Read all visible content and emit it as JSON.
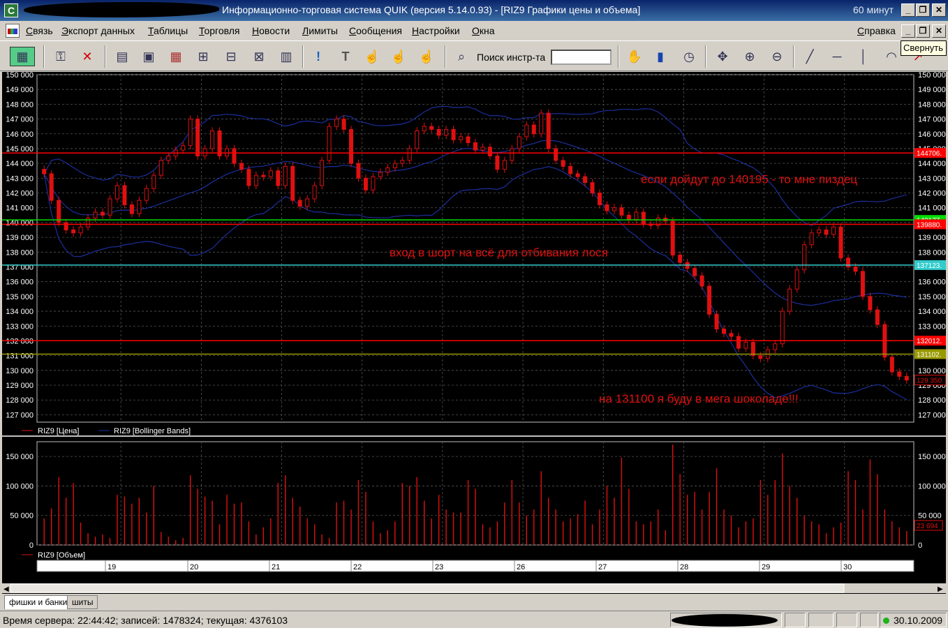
{
  "window": {
    "title": "Информационно-торговая система QUIK (версия 5.14.0.93) - [RIZ9 Графики цены и объема]",
    "interval": "60 минут",
    "minimize": "_",
    "restore": "❐",
    "close": "✕"
  },
  "menu": {
    "items": [
      "Связь",
      "Экспорт данных",
      "Таблицы",
      "Торговля",
      "Новости",
      "Лимиты",
      "Сообщения",
      "Настройки",
      "Окна"
    ],
    "help": "Справка"
  },
  "toolbar": {
    "search_label": "Поиск инстр-та",
    "search_value": "",
    "tooltip": "Свернуть",
    "icons": [
      "quik-logo-icon",
      "key-icon",
      "disconnect-icon",
      "chart-table-icon",
      "chart-grid-icon",
      "table-colors-icon",
      "trades-icon",
      "search-table-icon",
      "remove-table-icon",
      "stack-table-icon",
      "alert-icon",
      "text-tool-icon",
      "hand-order-icon",
      "hand-cancel-icon",
      "hand-multi-icon",
      "find-instrument-icon",
      "hand-tool-icon",
      "bar-chart-icon",
      "clock-icon",
      "move-icon",
      "zoom-in-icon",
      "zoom-out-icon",
      "trend-line-icon",
      "horizontal-line-icon",
      "vertical-line-icon",
      "arc-icon",
      "cursor-icon"
    ]
  },
  "chart_data": {
    "type": "line",
    "price_ticks": [
      "150 000",
      "149 000",
      "148 000",
      "147 000",
      "146 000",
      "145 000",
      "144 000",
      "143 000",
      "142 000",
      "141 000",
      "140 000",
      "139 000",
      "138 000",
      "137 000",
      "136 000",
      "135 000",
      "134 000",
      "133 000",
      "132 000",
      "131 000",
      "130 000",
      "129 000",
      "128 000",
      "127 000"
    ],
    "ylim": [
      126500,
      150000
    ],
    "price_legend": [
      "RIZ9 [Цена]",
      "RIZ9 [Bollinger Bands]"
    ],
    "volume_legend": "RIZ9 [Объем]",
    "volume_ticks": [
      "150 000",
      "100 000",
      "50 000",
      "0"
    ],
    "volume_ylim": [
      0,
      175000
    ],
    "date_labels": [
      "19",
      "20",
      "21",
      "22",
      "23",
      "26",
      "27",
      "28",
      "29",
      "30"
    ],
    "horizontal_levels": [
      {
        "value": 144706,
        "label": "144706.",
        "color": "#ff0000"
      },
      {
        "value": 140177,
        "label": "140177.",
        "color": "#00dd00"
      },
      {
        "value": 139880,
        "label": "139880.",
        "color": "#ff0000"
      },
      {
        "value": 137123,
        "label": "137123.",
        "color": "#33cccc"
      },
      {
        "value": 132012,
        "label": "132012.",
        "color": "#ff0000"
      },
      {
        "value": 131102,
        "label": "131102.",
        "color": "#999900"
      }
    ],
    "last_price": {
      "value": 129350,
      "label": "129 350"
    },
    "last_volume": "23 694",
    "annotations": [
      {
        "text": "если дойдут до 140195 - то мне пиздец",
        "at_price": 142950
      },
      {
        "text": "вход в шорт на всё для отбивания лося",
        "at_price": 138000
      },
      {
        "text": "на 131100 я буду в мега шоколаде!!!",
        "at_price": 128100
      }
    ],
    "close_series": [
      143300,
      141500,
      140000,
      139500,
      139300,
      139700,
      140300,
      140700,
      140500,
      141600,
      142500,
      141200,
      140600,
      141500,
      142300,
      143200,
      144200,
      144500,
      144900,
      145200,
      147000,
      144500,
      145000,
      146200,
      144500,
      145000,
      144000,
      143600,
      142500,
      143200,
      143100,
      143500,
      142500,
      143800,
      141500,
      141100,
      141600,
      142500,
      144200,
      146500,
      147000,
      146300,
      144000,
      143000,
      142200,
      143100,
      143400,
      143700,
      144000,
      144200,
      145000,
      146200,
      146500,
      146300,
      145900,
      146300,
      145600,
      145800,
      145400,
      144900,
      145100,
      144500,
      143600,
      144200,
      145000,
      145800,
      146600,
      146000,
      147400,
      145000,
      144200,
      143800,
      143300,
      143100,
      142700,
      142000,
      141200,
      140800,
      141000,
      140500,
      140200,
      140700,
      139900,
      139800,
      140300,
      140100,
      137800,
      137300,
      136900,
      136400,
      135700,
      133800,
      132800,
      132500,
      132300,
      131500,
      131900,
      131000,
      130800,
      131400,
      131800,
      134000,
      135500,
      136800,
      138500,
      139300,
      139500,
      139200,
      139700,
      137600,
      137000,
      136700,
      135000,
      134100,
      133100,
      130900,
      129900,
      129600,
      129350
    ],
    "volume_series": [
      45000,
      62000,
      115000,
      80000,
      105000,
      38000,
      20000,
      14000,
      18000,
      12000,
      85000,
      82000,
      70000,
      80000,
      55000,
      100000,
      22000,
      14000,
      8000,
      12000,
      118000,
      95000,
      82000,
      75000,
      35000,
      85000,
      70000,
      72000,
      40000,
      18000,
      30000,
      45000,
      105000,
      118000,
      80000,
      65000,
      45000,
      35000,
      18000,
      12000,
      72000,
      75000,
      60000,
      110000,
      90000,
      40000,
      20000,
      25000,
      40000,
      105000,
      100000,
      115000,
      75000,
      45000,
      85000,
      60000,
      55000,
      55000,
      110000,
      95000,
      35000,
      30000,
      40000,
      72000,
      110000,
      72000,
      50000,
      60000,
      125000,
      80000,
      60000,
      40000,
      45000,
      52000,
      75000,
      35000,
      60000,
      100000,
      80000,
      148000,
      95000,
      40000,
      35000,
      40000,
      60000,
      25000,
      170000,
      120000,
      85000,
      90000,
      60000,
      90000,
      130000,
      60000,
      50000,
      30000,
      40000,
      45000,
      110000,
      85000,
      110000,
      155000,
      100000,
      80000,
      50000,
      40000,
      35000,
      20000,
      30000,
      38000,
      125000,
      110000,
      60000,
      145000,
      120000,
      60000,
      40000,
      30000,
      23694
    ]
  },
  "tabs": [
    "фишки и банки",
    "шиты"
  ],
  "status": {
    "text": "Время сервера: 22:44:42; записей: 1478324; текущая: 4376103",
    "date": "30.10.2009"
  }
}
